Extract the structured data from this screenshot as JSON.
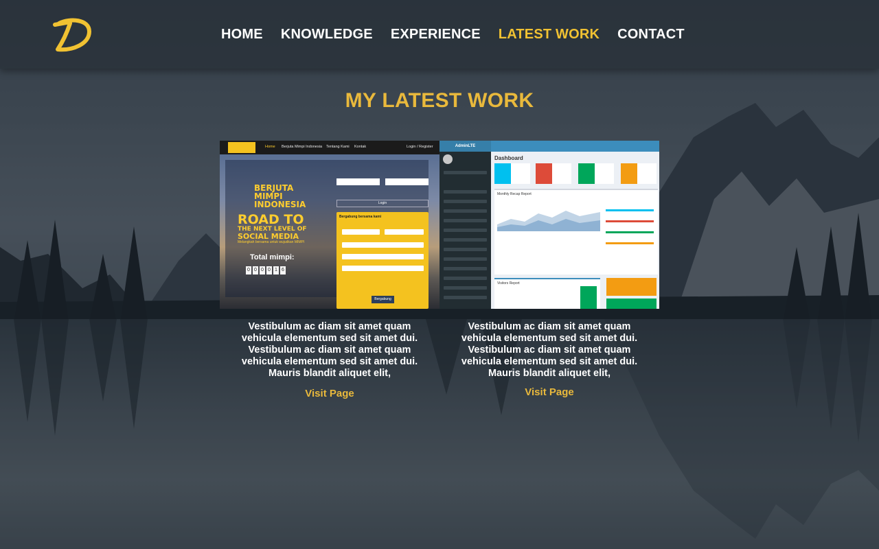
{
  "header": {
    "logo_letter": "D",
    "nav": [
      {
        "label": "HOME",
        "active": false
      },
      {
        "label": "KNOWLEDGE",
        "active": false
      },
      {
        "label": "EXPERIENCE",
        "active": false
      },
      {
        "label": "LATEST WORK",
        "active": true
      },
      {
        "label": "CONTACT",
        "active": false
      }
    ]
  },
  "section": {
    "title": "MY LATEST WORK"
  },
  "works": [
    {
      "description": "Vestibulum ac diam sit amet quam vehicula elementum sed sit amet dui. Vestibulum ac diam sit amet quam vehicula elementum sed sit amet dui. Mauris blandit aliquet elit,",
      "link_label": "Visit Page",
      "thumb": {
        "menu": [
          "Home",
          "Berjuta Mimpi Indonesia",
          "Tentang Kami",
          "Kontak",
          "Login / Register"
        ],
        "headline_1": "BERJUTA",
        "headline_2": "MIMPI",
        "headline_3": "INDONESIA",
        "road_1": "ROAD TO",
        "road_2": "THE NEXT LEVEL OF",
        "road_3": "SOCIAL MEDIA",
        "tagline": "Melangkah bersama untuk wujudkan MIMPI",
        "total_label": "Total mimpi:",
        "digits": [
          "0",
          "0",
          "0",
          "0",
          "1",
          "6"
        ],
        "login_button": "Login",
        "form_title": "Bergabung bersama kami",
        "join_button": "Bergabung"
      }
    },
    {
      "description": "Vestibulum ac diam sit amet quam vehicula elementum sed sit amet dui. Vestibulum ac diam sit amet quam vehicula elementum sed sit amet dui. Mauris blandit aliquet elit,",
      "link_label": "Visit Page",
      "thumb": {
        "brand": "AdminLTE",
        "title": "Dashboard",
        "report_title": "Monthly Recap Report",
        "visitors_title": "Visitors Report",
        "tiles": [
          {
            "color": "#00c0ef"
          },
          {
            "color": "#dd4b39"
          },
          {
            "color": "#00a65a"
          },
          {
            "color": "#f39c12"
          }
        ]
      }
    }
  ],
  "colors": {
    "accent": "#e9b93c",
    "nav_active": "#f1c232",
    "text": "#ffffff"
  }
}
